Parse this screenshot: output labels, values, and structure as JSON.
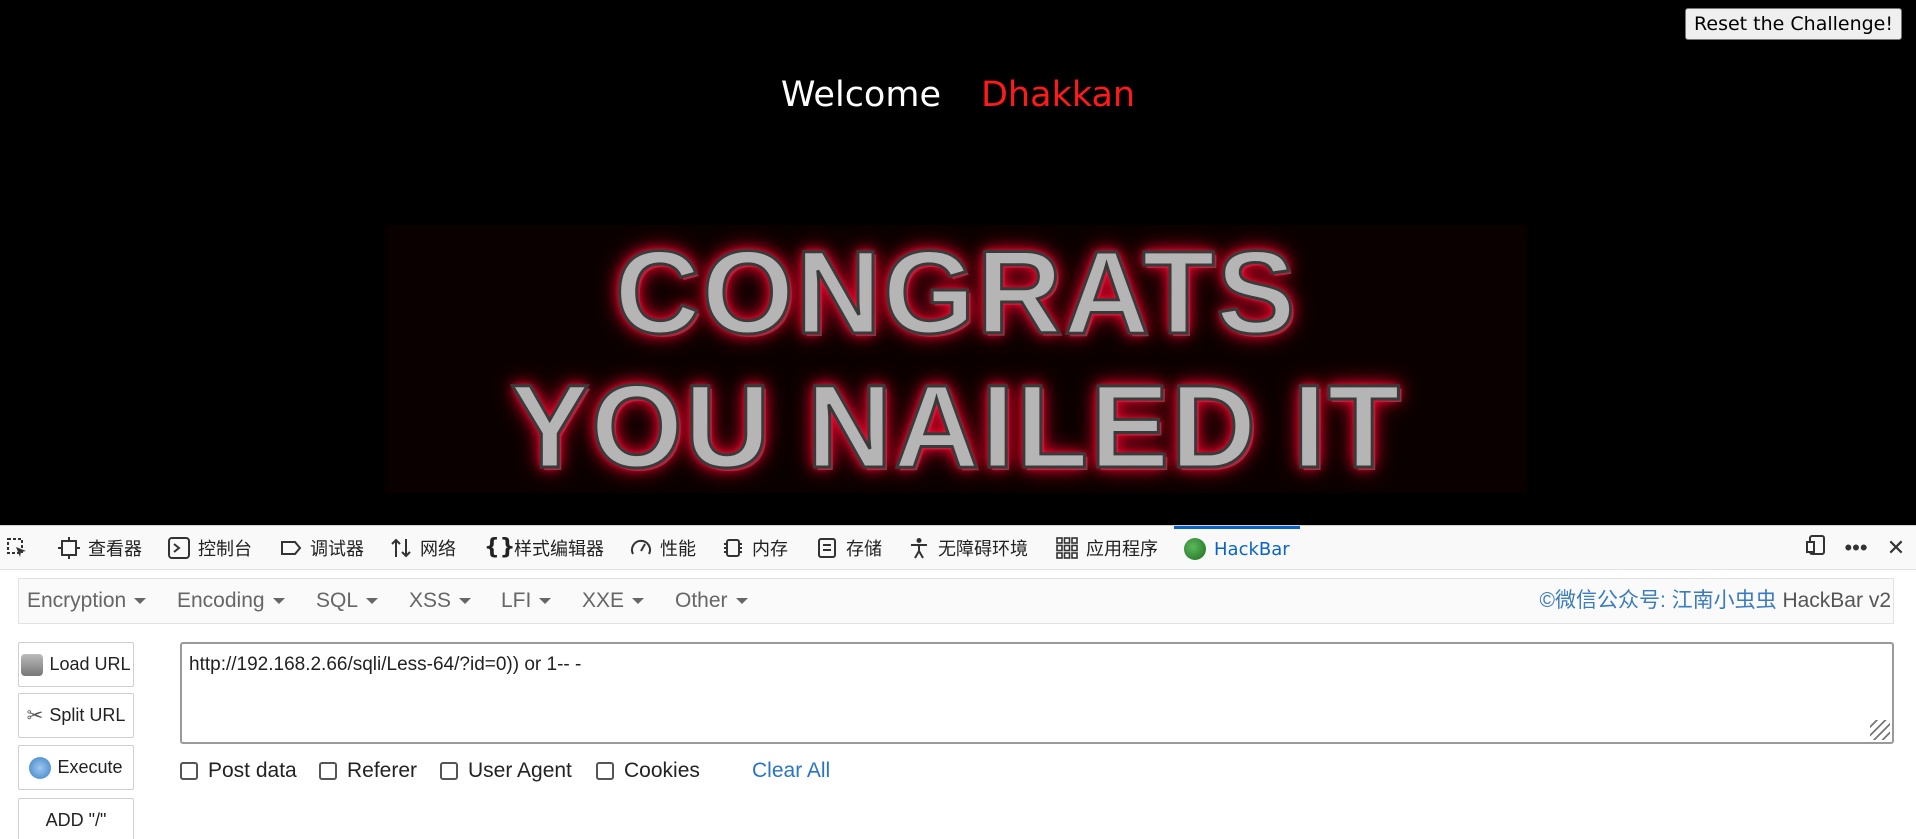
{
  "page": {
    "reset_button": "Reset the Challenge!",
    "welcome": "Welcome",
    "user_name": "Dhakkan",
    "banner_line1": "CONGRATS",
    "banner_line2": "YOU NAILED IT"
  },
  "devtools": {
    "tabs": [
      {
        "label": "查看器",
        "icon": "inspector-icon"
      },
      {
        "label": "控制台",
        "icon": "console-icon"
      },
      {
        "label": "调试器",
        "icon": "debugger-icon"
      },
      {
        "label": "网络",
        "icon": "network-icon"
      },
      {
        "label": "样式编辑器",
        "icon": "style-editor-icon"
      },
      {
        "label": "性能",
        "icon": "performance-icon"
      },
      {
        "label": "内存",
        "icon": "memory-icon"
      },
      {
        "label": "存储",
        "icon": "storage-icon"
      },
      {
        "label": "无障碍环境",
        "icon": "accessibility-icon"
      },
      {
        "label": "应用程序",
        "icon": "application-icon"
      },
      {
        "label": "HackBar",
        "icon": "hackbar-icon",
        "active": true
      }
    ],
    "active_color": "#0a64c8"
  },
  "hackbar": {
    "menu": [
      "Encryption",
      "Encoding",
      "SQL",
      "XSS",
      "LFI",
      "XXE",
      "Other"
    ],
    "brand_prefix": "©微信公众号: 江南小虫虫",
    "brand_suffix": " HackBar v2",
    "buttons": {
      "load_url": "Load URL",
      "split_url": "Split URL",
      "execute": "Execute",
      "add_slash": "ADD \"/\""
    },
    "url": "http://192.168.2.66/sqli/Less-64/?id=0)) or 1-- -",
    "options": {
      "post_data": "Post data",
      "referer": "Referer",
      "user_agent": "User Agent",
      "cookies": "Cookies"
    },
    "clear_all": "Clear All"
  }
}
